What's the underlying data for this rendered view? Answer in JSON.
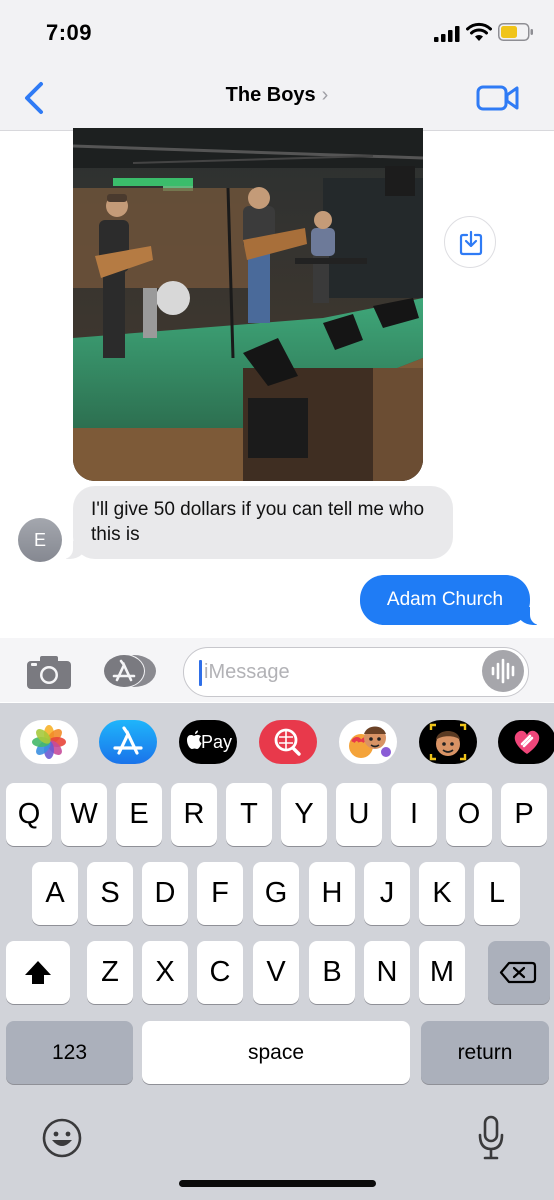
{
  "status_bar": {
    "time": "7:09"
  },
  "nav": {
    "title": "The Boys",
    "title_chevron": "›"
  },
  "messages": {
    "incoming_text": "I'll give 50 dollars if you can tell  me who this is",
    "sender_initial": "E",
    "outgoing_text": "Adam Church"
  },
  "compose": {
    "placeholder": "iMessage"
  },
  "app_strip": {
    "items": [
      "photos-app",
      "app-store-app",
      "apple-pay-app",
      "web-search-app",
      "memoji-stickers-app",
      "animoji-app",
      "digital-touch-app"
    ],
    "apple_pay_label": "Pay"
  },
  "keyboard": {
    "row1": [
      "Q",
      "W",
      "E",
      "R",
      "T",
      "Y",
      "U",
      "I",
      "O",
      "P"
    ],
    "row2": [
      "A",
      "S",
      "D",
      "F",
      "G",
      "H",
      "J",
      "K",
      "L"
    ],
    "row3": [
      "Z",
      "X",
      "C",
      "V",
      "B",
      "N",
      "M"
    ],
    "numbers_label": "123",
    "space_label": "space",
    "return_label": "return"
  },
  "colors": {
    "accent_blue": "#1f7cf5",
    "incoming_bubble": "#e9e9eb",
    "keyboard_bg": "#d1d3d9"
  }
}
